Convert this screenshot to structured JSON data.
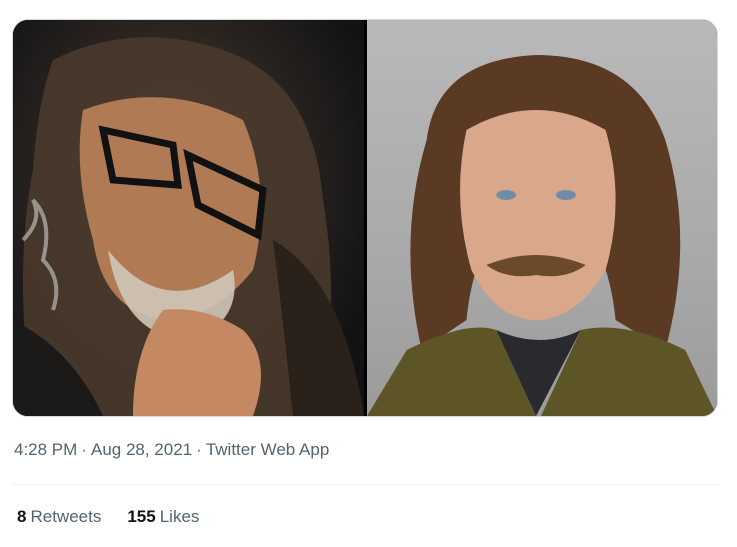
{
  "tweet": {
    "media": [
      {
        "alt": "",
        "kind": "photo"
      },
      {
        "alt": "",
        "kind": "photo"
      }
    ],
    "time": "4:28 PM",
    "separator": "·",
    "date": "Aug 28, 2021",
    "source": "Twitter Web App",
    "stats": {
      "retweets_count": "8",
      "retweets_label": "Retweets",
      "likes_count": "155",
      "likes_label": "Likes"
    }
  }
}
